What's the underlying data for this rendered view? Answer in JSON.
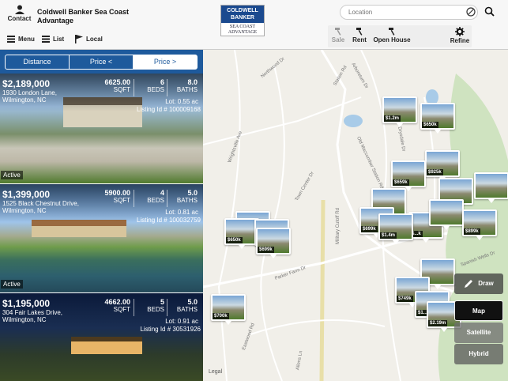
{
  "header": {
    "contact_label": "Contact",
    "agent_name": "Coldwell Banker Sea Coast Advantage",
    "view_menu": "Menu",
    "view_list": "List",
    "view_local": "Local",
    "logo_top": "COLDWELL BANKER",
    "logo_bottom": "SEA COAST ADVANTAGE",
    "location_placeholder": "Location",
    "filters": {
      "sale": "Sale",
      "rent": "Rent",
      "open_house": "Open House",
      "refine": "Refine"
    }
  },
  "sort": {
    "distance": "Distance",
    "price_asc": "Price <",
    "price_desc": "Price >"
  },
  "listings": [
    {
      "price": "$2,189,000",
      "address": "1930 London Lane,",
      "city": "Wilmington, NC",
      "sqft": "6625.00",
      "beds": "6",
      "baths": "8.0",
      "lot": "Lot: 0.55 ac",
      "listing_id": "Listing Id # 100009168",
      "status": "Active"
    },
    {
      "price": "$1,399,000",
      "address": "1525 Black Chestnut Drive,",
      "city": "Wilmington, NC",
      "sqft": "5900.00",
      "beds": "4",
      "baths": "5.0",
      "lot": "Lot: 0.81 ac",
      "listing_id": "Listing Id # 100032759",
      "status": "Active"
    },
    {
      "price": "$1,195,000",
      "address": "304 Fair Lakes Drive,",
      "city": "Wilmington, NC",
      "sqft": "4662.00",
      "beds": "5",
      "baths": "5.0",
      "lot": "Lot: 0.91 ac",
      "listing_id": "Listing Id # 30531926"
    }
  ],
  "stat_labels": {
    "sqft": "SQFT",
    "beds": "BEDS",
    "baths": "BATHS"
  },
  "map": {
    "pins": [
      "$1.2m",
      "$650k",
      "$925k",
      "$659k",
      "$699k",
      "$1.4m",
      "$650k",
      "$699k",
      "$899k",
      "$749k",
      "$1...",
      "$2.19m",
      "$700k",
      "$...k"
    ],
    "streets": [
      "Military Cutoff Rd",
      "Eastwood Rd",
      "Parker Farm Dr",
      "Station Rd",
      "Old Maccumber Station Rd",
      "Spanish Wells Dr",
      "Arboretum Dr",
      "Northwood Dr",
      "Wrightsville Ave",
      "Town Center Dr",
      "Drysdale Dr",
      "Allens Ln"
    ],
    "legal": "Legal",
    "types": {
      "draw": "Draw",
      "map": "Map",
      "satellite": "Satellite",
      "hybrid": "Hybrid"
    }
  }
}
